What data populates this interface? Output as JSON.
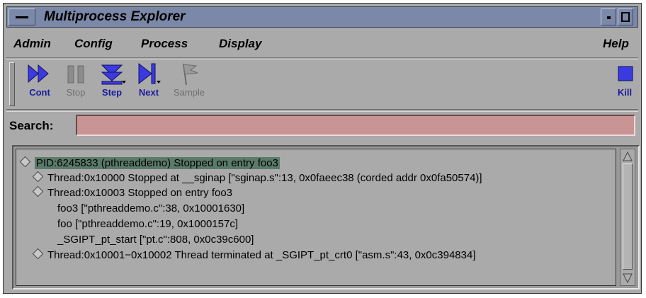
{
  "window": {
    "title": "Multiprocess Explorer"
  },
  "menu": {
    "items": [
      "Admin",
      "Config",
      "Process",
      "Display"
    ],
    "help": "Help"
  },
  "toolbar": {
    "cont": "Cont",
    "stop": "Stop",
    "step": "Step",
    "next": "Next",
    "sample": "Sample",
    "kill": "Kill"
  },
  "search": {
    "label": "Search:",
    "value": ""
  },
  "tree": {
    "rows": [
      "PID:6245833  (pthreaddemo)  Stopped on entry foo3",
      "Thread:0x10000  Stopped  at  __sginap [\"sginap.s\":13, 0x0faeec38 (corded addr 0x0fa50574)]",
      "Thread:0x10003  Stopped on entry foo3",
      "foo3 [\"pthreaddemo.c\":38, 0x10001630]",
      "foo [\"pthreaddemo.c\":19, 0x1000157c]",
      "_SGIPT_pt_start [\"pt.c\":808, 0x0c39c600]",
      "Thread:0x10001−0x10002  Thread terminated   at  _SGIPT_pt_crt0 [\"asm.s\":43, 0x0c394834]"
    ]
  },
  "colors": {
    "titlebar": "#7b88a8",
    "accent": "#3030d0",
    "search_bg": "#c89494",
    "selection": "#5a7a6a"
  }
}
